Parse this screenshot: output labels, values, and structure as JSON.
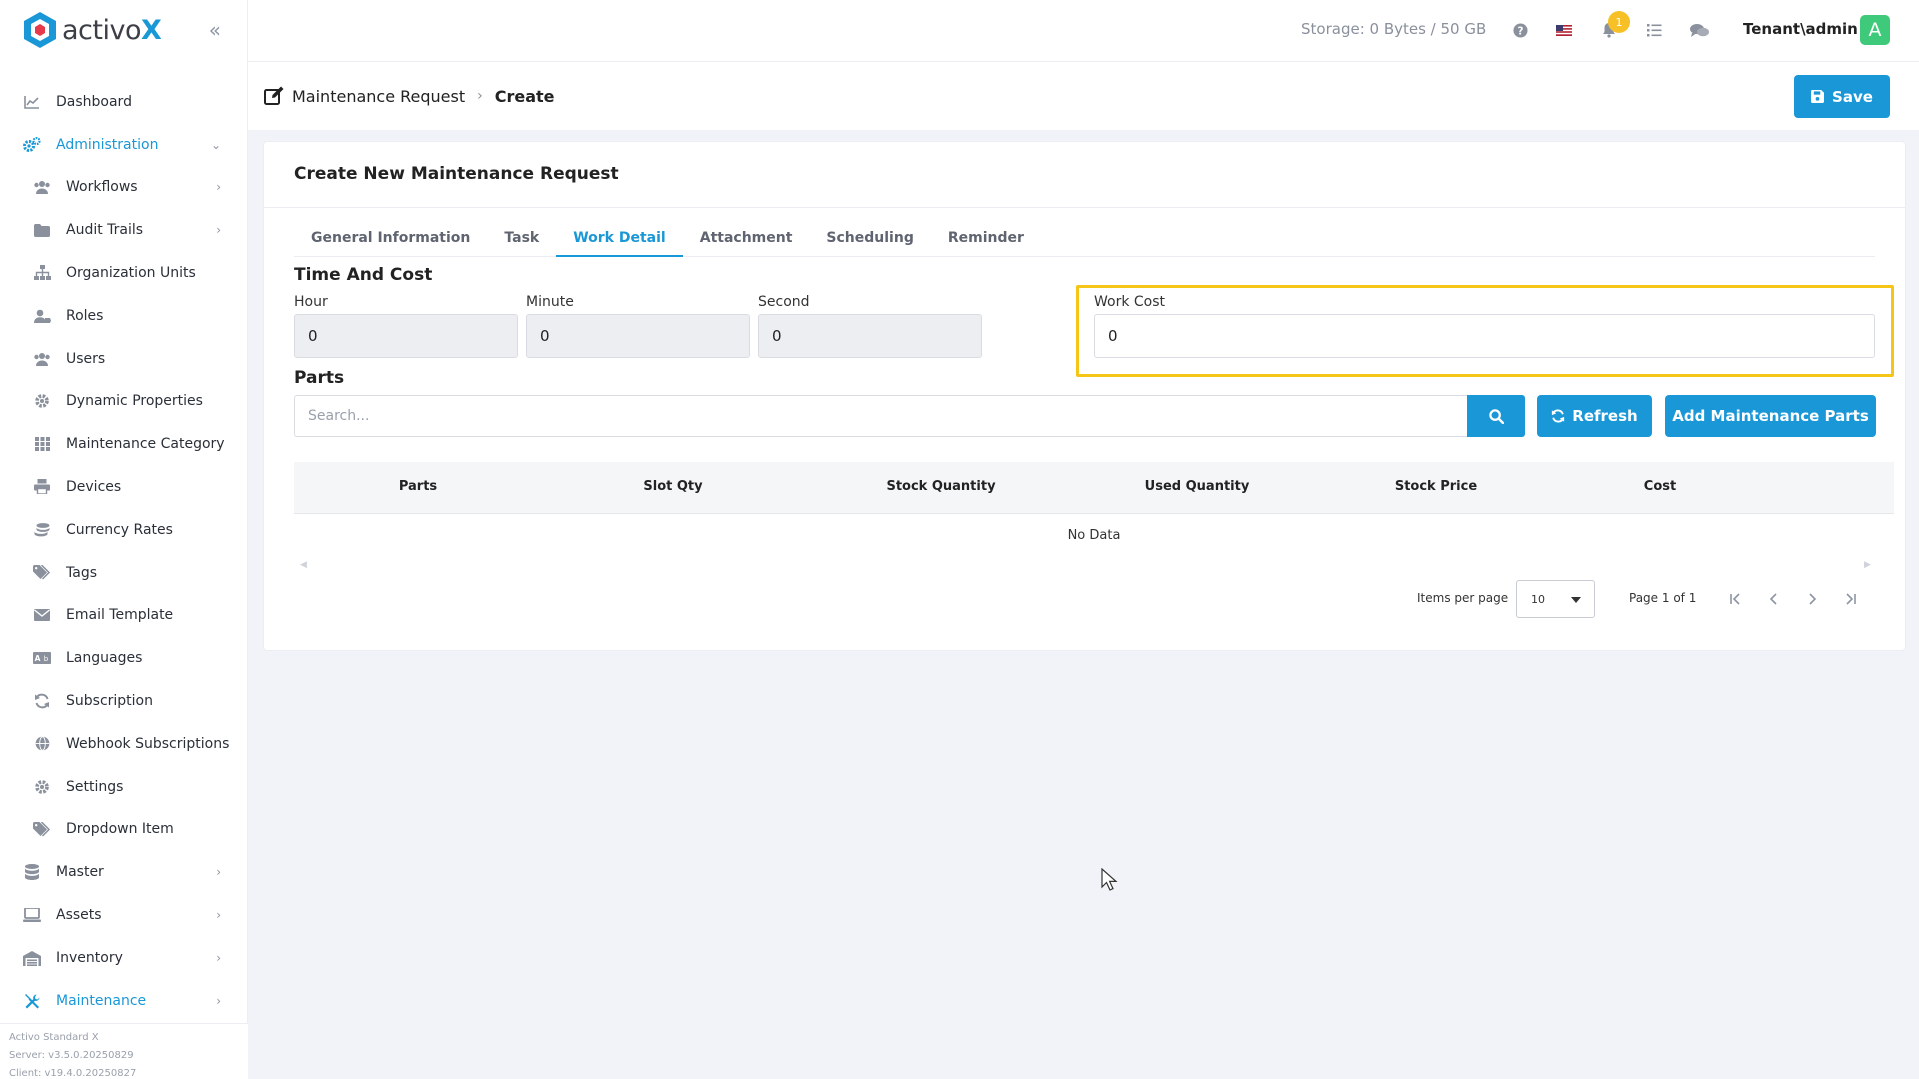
{
  "brand": {
    "prefix": "activo",
    "suffix": "X",
    "color": "#1a97d6"
  },
  "sidebar": {
    "collapse_icon": "double-chevron-left-icon",
    "items": [
      {
        "label": "Dashboard",
        "icon": "chart-line-icon"
      },
      {
        "label": "Administration",
        "icon": "cogs-icon",
        "active": true,
        "expanded": true
      },
      {
        "label": "Workflows",
        "icon": "users-icon",
        "sub": true,
        "has_children": true
      },
      {
        "label": "Audit Trails",
        "icon": "folder-icon",
        "sub": true,
        "has_children": true
      },
      {
        "label": "Organization Units",
        "icon": "sitemap-icon",
        "sub": true
      },
      {
        "label": "Roles",
        "icon": "user-tag-icon",
        "sub": true
      },
      {
        "label": "Users",
        "icon": "users-icon",
        "sub": true
      },
      {
        "label": "Dynamic Properties",
        "icon": "gear-icon",
        "sub": true
      },
      {
        "label": "Maintenance Category",
        "icon": "grid-icon",
        "sub": true
      },
      {
        "label": "Devices",
        "icon": "printer-icon",
        "sub": true
      },
      {
        "label": "Currency Rates",
        "icon": "coins-icon",
        "sub": true
      },
      {
        "label": "Tags",
        "icon": "tags-icon",
        "sub": true
      },
      {
        "label": "Email Template",
        "icon": "envelope-icon",
        "sub": true
      },
      {
        "label": "Languages",
        "icon": "language-icon",
        "sub": true
      },
      {
        "label": "Subscription",
        "icon": "sync-icon",
        "sub": true
      },
      {
        "label": "Webhook Subscriptions",
        "icon": "globe-icon",
        "sub": true
      },
      {
        "label": "Settings",
        "icon": "gear-icon",
        "sub": true
      },
      {
        "label": "Dropdown Item",
        "icon": "tags-icon",
        "sub": true
      },
      {
        "label": "Master",
        "icon": "database-icon",
        "has_children": true
      },
      {
        "label": "Assets",
        "icon": "laptop-icon",
        "has_children": true
      },
      {
        "label": "Inventory",
        "icon": "warehouse-icon",
        "has_children": true
      },
      {
        "label": "Maintenance",
        "icon": "tools-icon",
        "active": true,
        "has_children": true
      }
    ],
    "footer": {
      "product": "Activo Standard X",
      "server": "Server: v3.5.0.20250829",
      "client": "Client: v19.4.0.20250827"
    }
  },
  "topbar": {
    "storage": "Storage: 0 Bytes / 50 GB",
    "notification_count": "1",
    "user": "Tenant\\admin",
    "avatar_letter": "A",
    "avatar_color": "#3fc97a"
  },
  "breadcrumb": {
    "parent": "Maintenance Request",
    "current": "Create"
  },
  "save_label": "Save",
  "form": {
    "title": "Create New Maintenance Request",
    "tabs": [
      "General Information",
      "Task",
      "Work Detail",
      "Attachment",
      "Scheduling",
      "Reminder"
    ],
    "active_tab": "Work Detail",
    "time_cost": {
      "title": "Time And Cost",
      "hour_label": "Hour",
      "hour": "0",
      "minute_label": "Minute",
      "minute": "0",
      "second_label": "Second",
      "second": "0",
      "work_cost_label": "Work Cost",
      "work_cost": "0"
    },
    "parts": {
      "title": "Parts",
      "search_placeholder": "Search...",
      "refresh_label": "Refresh",
      "add_label": "Add Maintenance Parts",
      "columns": [
        "Parts",
        "Slot Qty",
        "Stock Quantity",
        "Used Quantity",
        "Stock Price",
        "Cost"
      ],
      "empty_text": "No Data",
      "items_per_page_label": "Items per page",
      "items_per_page": "10",
      "page_info": "Page 1 of 1"
    }
  },
  "highlight_color": "#f5c518"
}
